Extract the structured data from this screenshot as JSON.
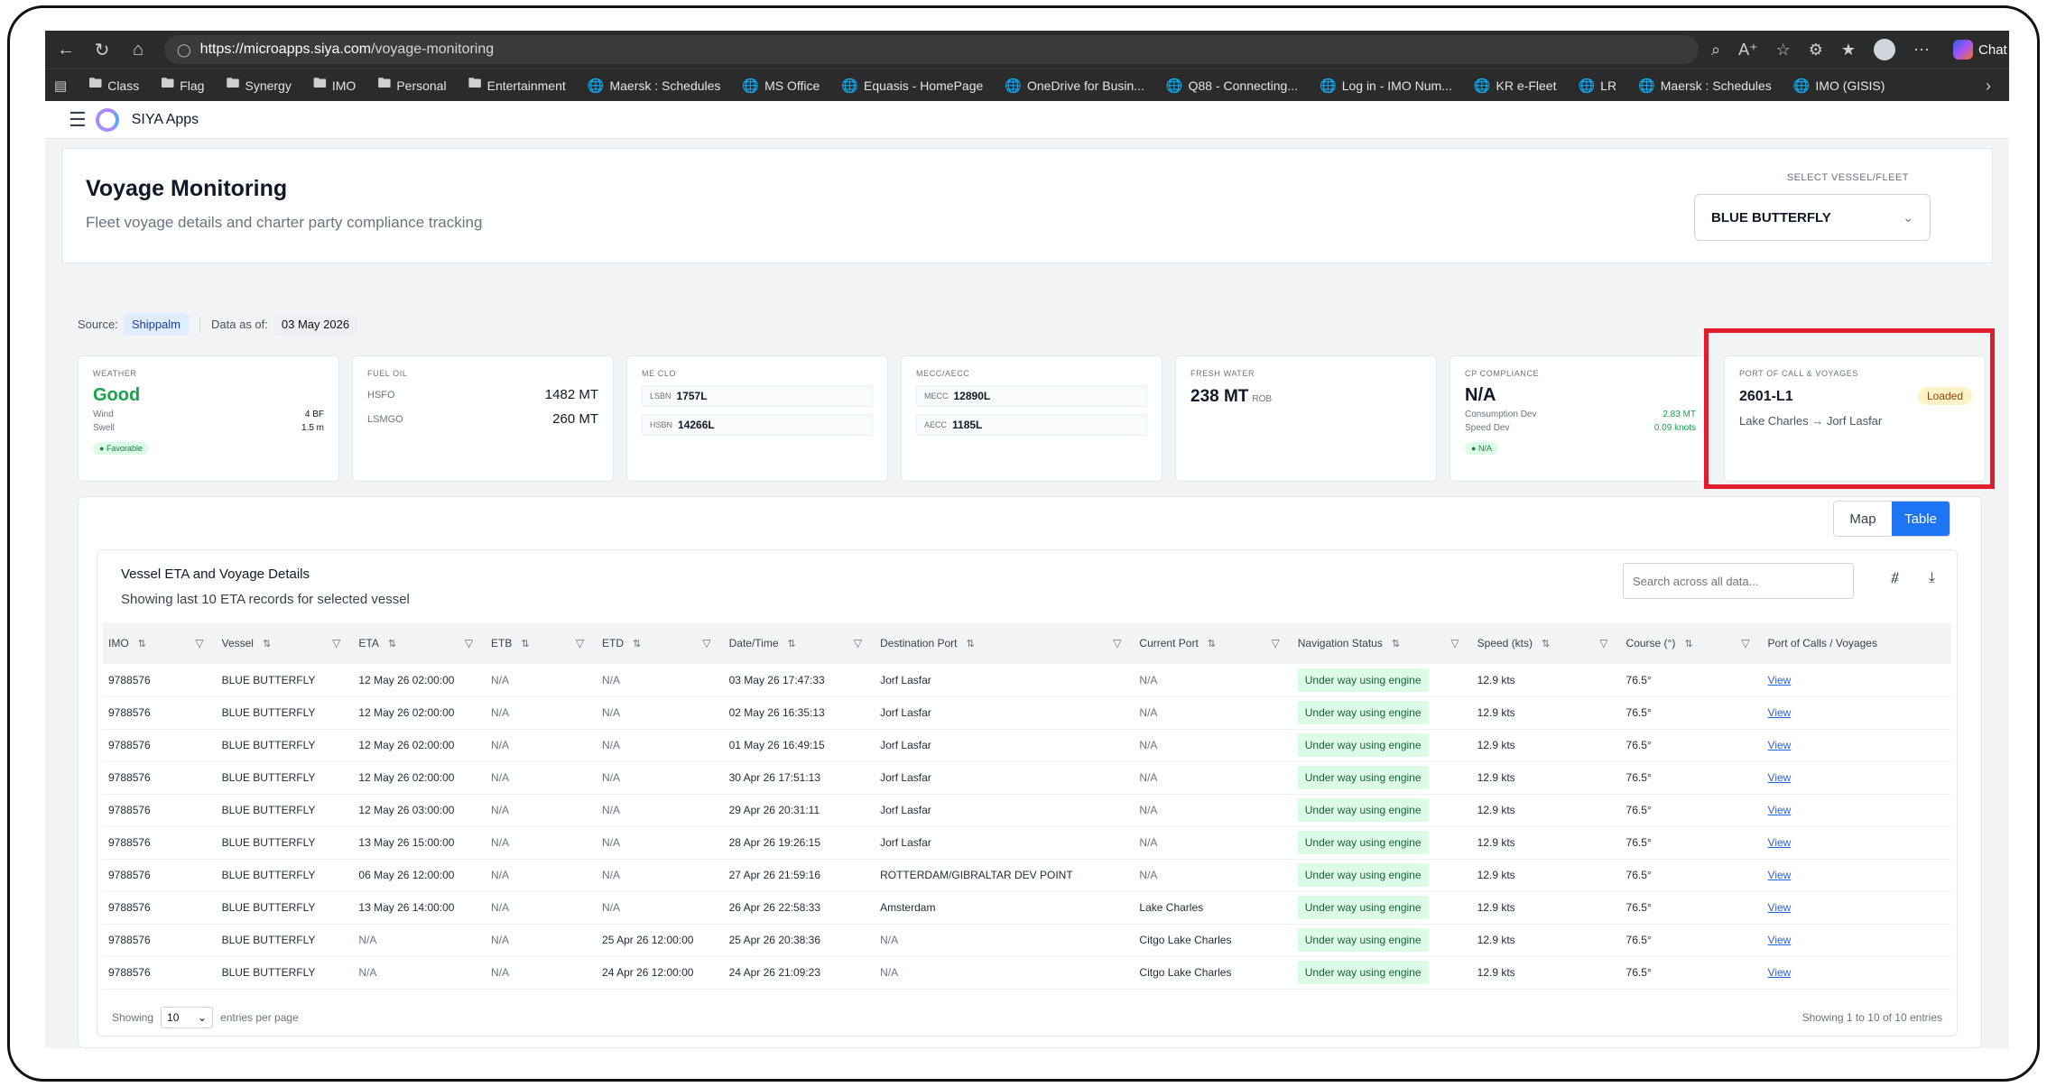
{
  "browser": {
    "url_host": "https://microapps.siya.com",
    "url_path": "/voyage-monitoring",
    "chat_label": "Chat",
    "bookmarks": [
      "Class",
      "Flag",
      "Synergy",
      "IMO",
      "Personal",
      "Entertainment",
      "Maersk : Schedules",
      "MS Office",
      "Equasis - HomePage",
      "OneDrive for Busin...",
      "Q88 - Connecting...",
      "Log in - IMO Num...",
      "KR e-Fleet",
      "LR",
      "Maersk : Schedules",
      "IMO (GISIS)"
    ]
  },
  "app": {
    "name": "SIYA Apps"
  },
  "page": {
    "title": "Voyage Monitoring",
    "subtitle": "Fleet voyage details and charter party compliance tracking",
    "select_label": "SELECT VESSEL/FLEET",
    "selected_vessel": "BLUE BUTTERFLY"
  },
  "source": {
    "label": "Source:",
    "value": "Shippalm",
    "date_label": "Data as of:",
    "date": "03 May 2026"
  },
  "cards": {
    "weather": {
      "label": "WEATHER",
      "value": "Good",
      "wind_label": "Wind",
      "wind": "4 BF",
      "swell_label": "Swell",
      "swell": "1.5 m",
      "badge": "Favorable"
    },
    "fuel": {
      "label": "FUEL OIL",
      "hsfo_label": "HSFO",
      "hsfo": "1482 MT",
      "lsmgo_label": "LSMGO",
      "lsmgo": "260 MT"
    },
    "meclo": {
      "label": "ME CLO",
      "a_label": "LSBN",
      "a": "1757L",
      "b_label": "HSBN",
      "b": "14266L"
    },
    "mecc": {
      "label": "MECC/AECC",
      "a_label": "MECC",
      "a": "12890L",
      "b_label": "AECC",
      "b": "1185L"
    },
    "water": {
      "label": "FRESH WATER",
      "value": "238 MT",
      "unit": "ROB"
    },
    "cp": {
      "label": "CP COMPLIANCE",
      "value": "N/A",
      "cons_label": "Consumption Dev",
      "cons": "2.83 MT",
      "speed_label": "Speed Dev",
      "speed": "0.09 knots",
      "badge": "N/A"
    },
    "port": {
      "label": "PORT OF CALL & VOYAGES",
      "voyage": "2601-L1",
      "status": "Loaded",
      "route": "Lake Charles → Jorf Lasfar"
    }
  },
  "view_toggle": {
    "map": "Map",
    "table": "Table"
  },
  "table": {
    "title": "Vessel ETA and Voyage Details",
    "subtitle": "Showing last 10 ETA records for selected vessel",
    "search_placeholder": "Search across all data...",
    "columns": [
      "IMO",
      "Vessel",
      "ETA",
      "ETB",
      "ETD",
      "Date/Time",
      "Destination Port",
      "Current Port",
      "Navigation Status",
      "Speed (kts)",
      "Course (°)",
      "Port of Calls / Voyages"
    ],
    "rows": [
      [
        "9788576",
        "BLUE BUTTERFLY",
        "12 May 26 02:00:00",
        "N/A",
        "N/A",
        "03 May 26 17:47:33",
        "Jorf Lasfar",
        "N/A",
        "Under way using engine",
        "12.9 kts",
        "76.5°",
        "View"
      ],
      [
        "9788576",
        "BLUE BUTTERFLY",
        "12 May 26 02:00:00",
        "N/A",
        "N/A",
        "02 May 26 16:35:13",
        "Jorf Lasfar",
        "N/A",
        "Under way using engine",
        "12.9 kts",
        "76.5°",
        "View"
      ],
      [
        "9788576",
        "BLUE BUTTERFLY",
        "12 May 26 02:00:00",
        "N/A",
        "N/A",
        "01 May 26 16:49:15",
        "Jorf Lasfar",
        "N/A",
        "Under way using engine",
        "12.9 kts",
        "76.5°",
        "View"
      ],
      [
        "9788576",
        "BLUE BUTTERFLY",
        "12 May 26 02:00:00",
        "N/A",
        "N/A",
        "30 Apr 26 17:51:13",
        "Jorf Lasfar",
        "N/A",
        "Under way using engine",
        "12.9 kts",
        "76.5°",
        "View"
      ],
      [
        "9788576",
        "BLUE BUTTERFLY",
        "12 May 26 03:00:00",
        "N/A",
        "N/A",
        "29 Apr 26 20:31:11",
        "Jorf Lasfar",
        "N/A",
        "Under way using engine",
        "12.9 kts",
        "76.5°",
        "View"
      ],
      [
        "9788576",
        "BLUE BUTTERFLY",
        "13 May 26 15:00:00",
        "N/A",
        "N/A",
        "28 Apr 26 19:26:15",
        "Jorf Lasfar",
        "N/A",
        "Under way using engine",
        "12.9 kts",
        "76.5°",
        "View"
      ],
      [
        "9788576",
        "BLUE BUTTERFLY",
        "06 May 26 12:00:00",
        "N/A",
        "N/A",
        "27 Apr 26 21:59:16",
        "ROTTERDAM/GIBRALTAR DEV POINT",
        "N/A",
        "Under way using engine",
        "12.9 kts",
        "76.5°",
        "View"
      ],
      [
        "9788576",
        "BLUE BUTTERFLY",
        "13 May 26 14:00:00",
        "N/A",
        "N/A",
        "26 Apr 26 22:58:33",
        "Amsterdam",
        "Lake Charles",
        "Under way using engine",
        "12.9 kts",
        "76.5°",
        "View"
      ],
      [
        "9788576",
        "BLUE BUTTERFLY",
        "N/A",
        "N/A",
        "25 Apr 26 12:00:00",
        "25 Apr 26 20:38:36",
        "N/A",
        "Citgo Lake Charles",
        "Under way using engine",
        "12.9 kts",
        "76.5°",
        "View"
      ],
      [
        "9788576",
        "BLUE BUTTERFLY",
        "N/A",
        "N/A",
        "24 Apr 26 12:00:00",
        "24 Apr 26 21:09:23",
        "N/A",
        "Citgo Lake Charles",
        "Under way using engine",
        "12.9 kts",
        "76.5°",
        "View"
      ]
    ],
    "footer_showing": "Showing",
    "page_size": "10",
    "footer_per_page": "entries per page",
    "footer_right": "Showing 1 to 10 of 10 entries"
  }
}
